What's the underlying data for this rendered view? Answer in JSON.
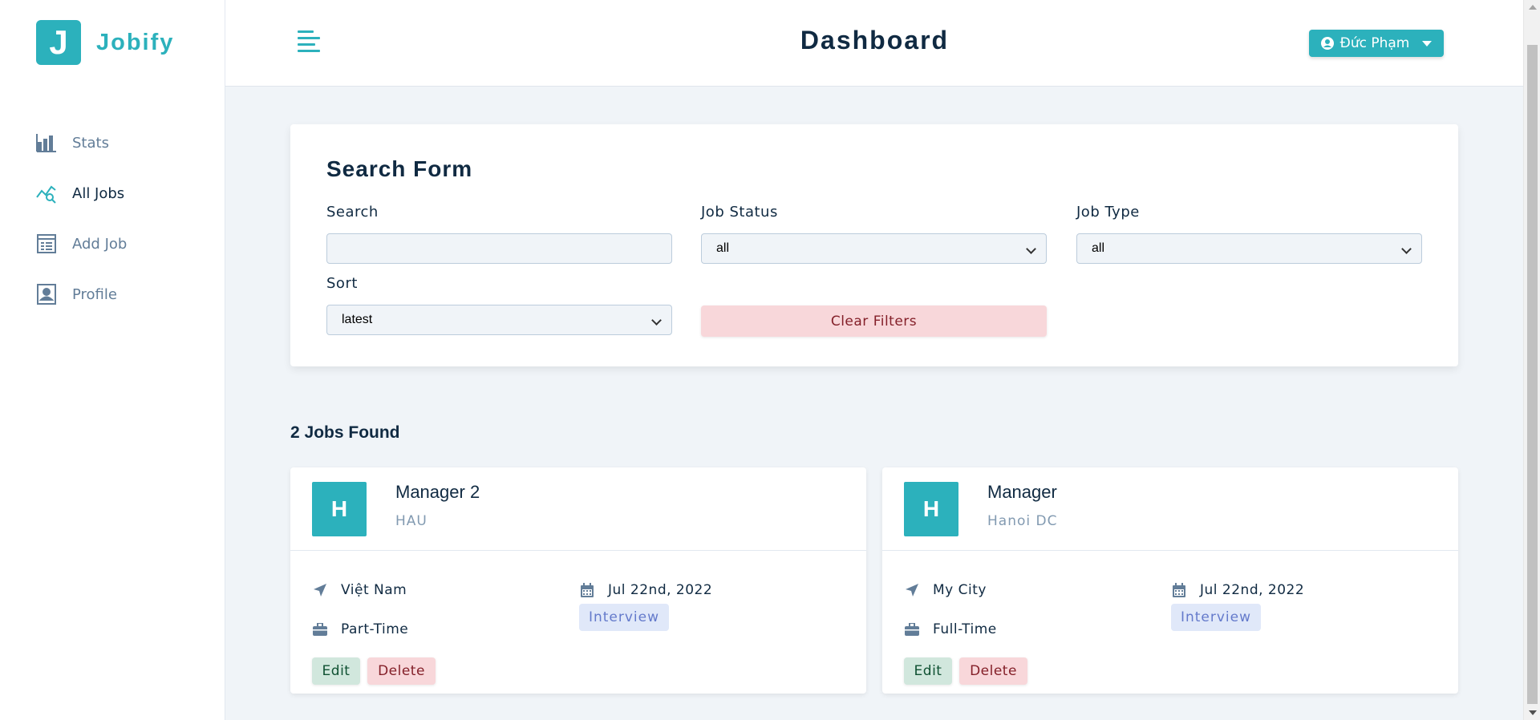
{
  "brand": {
    "logo_letter": "J",
    "name": "Jobify",
    "accent": "#2cb1bc"
  },
  "header": {
    "title": "Dashboard",
    "user_name": "Đức Phạm"
  },
  "sidebar": {
    "items": [
      {
        "label": "Stats",
        "icon": "bar-chart-icon",
        "active": false
      },
      {
        "label": "All Jobs",
        "icon": "query-stats-icon",
        "active": true
      },
      {
        "label": "Add Job",
        "icon": "form-icon",
        "active": false
      },
      {
        "label": "Profile",
        "icon": "profile-icon",
        "active": false
      }
    ]
  },
  "search_form": {
    "title": "Search Form",
    "search_label": "Search",
    "search_value": "",
    "status_label": "Job Status",
    "status_value": "all",
    "type_label": "Job Type",
    "type_value": "all",
    "sort_label": "Sort",
    "sort_value": "latest",
    "clear_label": "Clear Filters"
  },
  "jobs_found": "2 Jobs Found",
  "jobs": [
    {
      "avatar": "H",
      "position": "Manager 2",
      "company": "HAU",
      "location": "Việt Nam",
      "date": "Jul 22nd, 2022",
      "job_type": "Part-Time",
      "status": "Interview",
      "edit_label": "Edit",
      "delete_label": "Delete"
    },
    {
      "avatar": "H",
      "position": "Manager",
      "company": "Hanoi DC",
      "location": "My City",
      "date": "Jul 22nd, 2022",
      "job_type": "Full-Time",
      "status": "Interview",
      "edit_label": "Edit",
      "delete_label": "Delete"
    }
  ]
}
